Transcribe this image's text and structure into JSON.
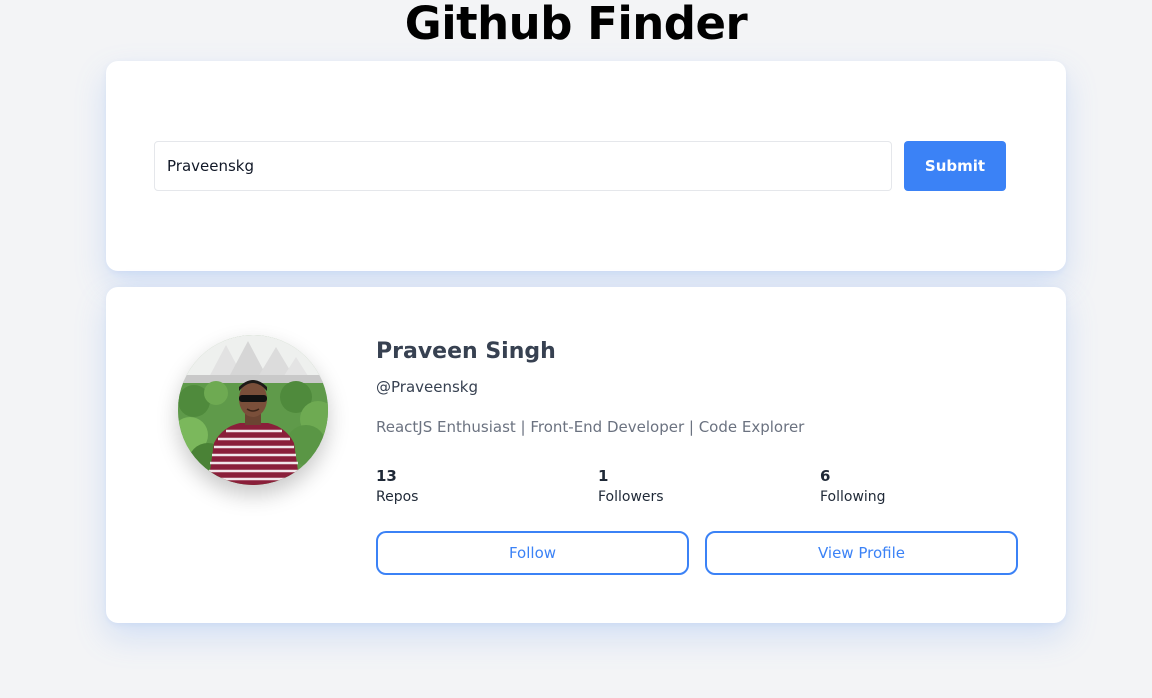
{
  "app": {
    "title": "Github Finder"
  },
  "search": {
    "value": "Praveenskg",
    "submit_label": "Submit"
  },
  "profile": {
    "name": "Praveen Singh",
    "login": "@Praveenskg",
    "bio": "ReactJS Enthusiast | Front-End Developer | Code Explorer",
    "stats": {
      "repos": {
        "value": "13",
        "label": "Repos"
      },
      "followers": {
        "value": "1",
        "label": "Followers"
      },
      "following": {
        "value": "6",
        "label": "Following"
      }
    },
    "follow_label": "Follow",
    "view_profile_label": "View Profile"
  },
  "colors": {
    "accent": "#3b82f6",
    "background": "#f3f4f6",
    "card": "#ffffff"
  }
}
